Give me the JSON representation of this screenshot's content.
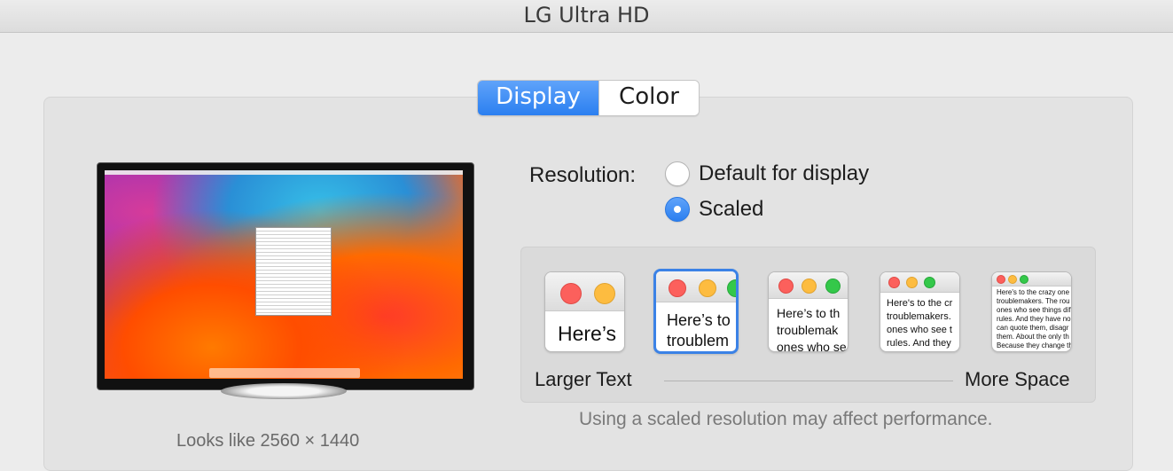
{
  "window": {
    "title": "LG Ultra HD"
  },
  "tabs": [
    {
      "label": "Display",
      "active": true
    },
    {
      "label": "Color",
      "active": false
    }
  ],
  "preview": {
    "looks_like": "Looks like 2560 × 1440"
  },
  "resolution": {
    "label": "Resolution:",
    "options": [
      {
        "label": "Default for display",
        "selected": false
      },
      {
        "label": "Scaled",
        "selected": true
      }
    ]
  },
  "scaled": {
    "choices": [
      {
        "text": "Here’s",
        "selected": false
      },
      {
        "text": "Here’s to\ntroublem",
        "selected": true
      },
      {
        "text": "Here’s to th\ntroublemak\nones who se",
        "selected": false
      },
      {
        "text": "Here's to the cr\ntroublemakers.\nones who see t\nrules. And they",
        "selected": false
      },
      {
        "text": "Here's to the crazy one\ntroublemakers. The rou\nones who see things dif\nrules. And they have no\ncan quote them, disagr\nthem. About the only th\nBecause they change th",
        "selected": false
      }
    ],
    "left_label": "Larger Text",
    "right_label": "More Space",
    "note": "Using a scaled resolution may affect performance."
  },
  "colors": {
    "accent": "#2b7ff0",
    "window_bg": "#ececec"
  }
}
